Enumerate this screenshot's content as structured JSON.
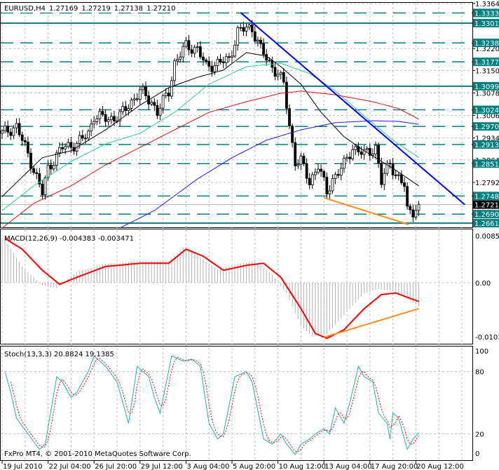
{
  "header": {
    "symbol": "EURUSD,H4",
    "open": "1.27169",
    "high": "1.27219",
    "low": "1.27138",
    "close": "1.27210"
  },
  "copyright": "FxPro MT4, © 2001-2010 MetaQuotes Software Corp.",
  "colors": {
    "teal": "#008080",
    "trend": "#0000ff",
    "divergence": "#ff8c1a",
    "ma_fast": "#000000",
    "ma_mid": "#33cc99",
    "ma_slow": "#dd1111",
    "ma_long": "#1a1aee",
    "macd_signal": "#ff0000",
    "stoch_main": "#20b2aa",
    "stoch_signal": "#ff0000"
  },
  "chart_data": [
    {
      "type": "candlestick",
      "title": "EURUSD,H4",
      "bars": 146,
      "close_anchors": [
        [
          0,
          1.2949
        ],
        [
          5,
          1.2971
        ],
        [
          9,
          1.2882
        ],
        [
          14,
          1.2758
        ],
        [
          16,
          1.2837
        ],
        [
          21,
          1.2904
        ],
        [
          26,
          1.2915
        ],
        [
          30,
          1.2949
        ],
        [
          32,
          1.3005
        ],
        [
          37,
          1.2994
        ],
        [
          41,
          1.3005
        ],
        [
          44,
          1.3039
        ],
        [
          48,
          1.3084
        ],
        [
          52,
          1.305
        ],
        [
          54,
          1.3016
        ],
        [
          58,
          1.3084
        ],
        [
          60,
          1.3173
        ],
        [
          64,
          1.3229
        ],
        [
          68,
          1.3218
        ],
        [
          71,
          1.3162
        ],
        [
          75,
          1.3173
        ],
        [
          79,
          1.3185
        ],
        [
          82,
          1.3274
        ],
        [
          85,
          1.3285
        ],
        [
          87,
          1.3285
        ],
        [
          90,
          1.3218
        ],
        [
          93,
          1.3173
        ],
        [
          96,
          1.314
        ],
        [
          98,
          1.3106
        ],
        [
          100,
          1.2971
        ],
        [
          102,
          1.2859
        ],
        [
          104,
          1.2859
        ],
        [
          107,
          1.2792
        ],
        [
          110,
          1.2848
        ],
        [
          113,
          1.2758
        ],
        [
          115,
          1.2803
        ],
        [
          119,
          1.2848
        ],
        [
          122,
          1.2904
        ],
        [
          126,
          1.2882
        ],
        [
          130,
          1.2904
        ],
        [
          132,
          1.2792
        ],
        [
          135,
          1.2859
        ],
        [
          137,
          1.2815
        ],
        [
          140,
          1.2781
        ],
        [
          141,
          1.2702
        ],
        [
          143,
          1.2702
        ],
        [
          145,
          1.2721
        ]
      ],
      "moving_averages": [
        {
          "name": "MA fast",
          "color_key": "ma_fast",
          "points": [
            [
              0,
              1.2747
            ],
            [
              14,
              1.2871
            ],
            [
              24,
              1.2893
            ],
            [
              36,
              1.296
            ],
            [
              48,
              1.3039
            ],
            [
              58,
              1.3095
            ],
            [
              68,
              1.3128
            ],
            [
              77,
              1.3151
            ],
            [
              85,
              1.3207
            ],
            [
              92,
              1.3196
            ],
            [
              97,
              1.3162
            ],
            [
              104,
              1.3106
            ],
            [
              111,
              1.3016
            ],
            [
              119,
              1.2938
            ],
            [
              126,
              1.2893
            ],
            [
              136,
              1.2837
            ],
            [
              145,
              1.2781
            ]
          ]
        },
        {
          "name": "MA mid",
          "color_key": "ma_mid",
          "points": [
            [
              0,
              1.2702
            ],
            [
              11,
              1.2781
            ],
            [
              24,
              1.2859
            ],
            [
              36,
              1.2915
            ],
            [
              48,
              1.2949
            ],
            [
              60,
              1.3016
            ],
            [
              72,
              1.3106
            ],
            [
              85,
              1.3162
            ],
            [
              97,
              1.3173
            ],
            [
              107,
              1.314
            ],
            [
              116,
              1.3084
            ],
            [
              126,
              1.3005
            ],
            [
              136,
              1.2927
            ],
            [
              145,
              1.2871
            ]
          ]
        },
        {
          "name": "MA slow",
          "color_key": "ma_slow",
          "points": [
            [
              0,
              1.2646
            ],
            [
              11,
              1.2725
            ],
            [
              24,
              1.2781
            ],
            [
              36,
              1.2848
            ],
            [
              48,
              1.2904
            ],
            [
              60,
              1.296
            ],
            [
              72,
              1.3016
            ],
            [
              85,
              1.305
            ],
            [
              97,
              1.3077
            ],
            [
              104,
              1.3084
            ],
            [
              116,
              1.3072
            ],
            [
              129,
              1.305
            ],
            [
              138,
              1.3028
            ],
            [
              145,
              1.2994
            ]
          ]
        },
        {
          "name": "MA long",
          "color_key": "ma_long",
          "points": [
            [
              41,
              1.2646
            ],
            [
              53,
              1.2702
            ],
            [
              68,
              1.2803
            ],
            [
              80,
              1.2871
            ],
            [
              92,
              1.2927
            ],
            [
              104,
              1.296
            ],
            [
              116,
              1.2983
            ],
            [
              129,
              1.2989
            ],
            [
              138,
              1.2987
            ],
            [
              145,
              1.2978
            ]
          ]
        }
      ],
      "trendlines": [
        {
          "name": "resistance",
          "color_key": "trend",
          "from": [
            83,
            1.3335
          ],
          "to": [
            161,
            1.2721
          ]
        },
        {
          "name": "price-divergence",
          "color_key": "divergence",
          "from": [
            112,
            1.2743
          ],
          "to": [
            141.5,
            1.2657
          ]
        }
      ],
      "levels": [
        {
          "value": "1.33338",
          "style": "dashed"
        },
        {
          "value": "1.33013",
          "style": "solid"
        },
        {
          "value": "1.32382",
          "style": "dashed"
        },
        {
          "value": "1.31775",
          "style": "dashed"
        },
        {
          "value": "1.30995",
          "style": "solid"
        },
        {
          "value": "1.30241",
          "style": "dashed"
        },
        {
          "value": "1.29709",
          "style": "dashed"
        },
        {
          "value": "1.29130",
          "style": "dashed"
        },
        {
          "value": "1.28519",
          "style": "dashed"
        },
        {
          "value": "1.27484",
          "style": "dashed"
        },
        {
          "value": "1.26905",
          "style": "dashed"
        },
        {
          "value": "1.26616",
          "style": "solid"
        }
      ],
      "current_price": "1.27210",
      "y_ticks": [
        "1.33640",
        "1.32200",
        "1.31500",
        "1.30780",
        "1.30060",
        "1.29340",
        "1.28640",
        "1.27920"
      ],
      "ylim": [
        1.265,
        1.3364
      ],
      "x_ticks": [
        [
          0,
          "19 Jul 2010"
        ],
        [
          16,
          "22 Jul 04:00"
        ],
        [
          32,
          "26 Jul 20:00"
        ],
        [
          48,
          "29 Jul 12:00"
        ],
        [
          64,
          "3 Aug 04:00"
        ],
        [
          80,
          "5 Aug 20:00"
        ],
        [
          96,
          "10 Aug 12:00"
        ],
        [
          112,
          "13 Aug 04:00"
        ],
        [
          128,
          "17 Aug 20:00"
        ],
        [
          144,
          "20 Aug 12:00"
        ]
      ]
    },
    {
      "type": "macd",
      "label": "MACD(12,26,9) -0.004383 -0.003471",
      "y_ticks": [
        "0.00857",
        "0.00",
        "-0.01038"
      ],
      "ylim": [
        -0.01038,
        0.00857
      ],
      "histogram": [
        [
          1,
          0.008
        ],
        [
          7,
          0.003
        ],
        [
          14,
          -0.0005
        ],
        [
          19,
          -0.001
        ],
        [
          26,
          0.002
        ],
        [
          36,
          0.0035
        ],
        [
          48,
          0.004
        ],
        [
          58,
          0.004
        ],
        [
          63,
          0.0065
        ],
        [
          68,
          0.005
        ],
        [
          75,
          0.0025
        ],
        [
          82,
          0.0035
        ],
        [
          88,
          0.004
        ],
        [
          94,
          0.0015
        ],
        [
          99,
          -0.002
        ],
        [
          104,
          -0.008
        ],
        [
          108,
          -0.01
        ],
        [
          113,
          -0.0095
        ],
        [
          119,
          -0.006
        ],
        [
          126,
          -0.002
        ],
        [
          131,
          -0.0012
        ],
        [
          136,
          -0.0015
        ],
        [
          141,
          -0.003
        ],
        [
          145,
          -0.004383
        ]
      ],
      "signal": [
        [
          1,
          0.0082
        ],
        [
          7,
          0.0062
        ],
        [
          14,
          0.0023
        ],
        [
          20,
          -0.0003
        ],
        [
          26,
          0.001
        ],
        [
          36,
          0.003
        ],
        [
          48,
          0.0036
        ],
        [
          58,
          0.0036
        ],
        [
          64,
          0.0062
        ],
        [
          70,
          0.0049
        ],
        [
          77,
          0.0023
        ],
        [
          85,
          0.0032
        ],
        [
          91,
          0.0036
        ],
        [
          97,
          0.001
        ],
        [
          104,
          -0.0048
        ],
        [
          109,
          -0.0094
        ],
        [
          113,
          -0.0103
        ],
        [
          119,
          -0.0087
        ],
        [
          126,
          -0.0048
        ],
        [
          132,
          -0.0022
        ],
        [
          137,
          -0.0019
        ],
        [
          142,
          -0.0029
        ],
        [
          145,
          -0.003471
        ]
      ],
      "divergence": {
        "from": [
          112,
          -0.0101
        ],
        "to": [
          145,
          -0.0048
        ]
      }
    },
    {
      "type": "stochastic",
      "label": "Stoch(13,3,3) 20.8824 19.1385",
      "y_ticks": [
        "100",
        "80",
        "20",
        "0"
      ],
      "ylim": [
        0,
        100
      ],
      "main": [
        [
          1,
          80
        ],
        [
          3,
          60
        ],
        [
          5,
          35
        ],
        [
          9,
          20
        ],
        [
          13,
          5
        ],
        [
          15,
          10
        ],
        [
          19,
          75
        ],
        [
          21,
          70
        ],
        [
          24,
          55
        ],
        [
          26,
          60
        ],
        [
          30,
          80
        ],
        [
          32,
          95
        ],
        [
          36,
          85
        ],
        [
          40,
          70
        ],
        [
          43,
          40
        ],
        [
          44,
          30
        ],
        [
          47,
          85
        ],
        [
          51,
          75
        ],
        [
          53,
          55
        ],
        [
          55,
          40
        ],
        [
          59,
          95
        ],
        [
          63,
          90
        ],
        [
          66,
          92
        ],
        [
          69,
          85
        ],
        [
          72,
          30
        ],
        [
          75,
          15
        ],
        [
          77,
          20
        ],
        [
          81,
          75
        ],
        [
          85,
          80
        ],
        [
          87,
          70
        ],
        [
          91,
          15
        ],
        [
          94,
          10
        ],
        [
          97,
          20
        ],
        [
          99,
          10
        ],
        [
          102,
          0
        ],
        [
          104,
          10
        ],
        [
          107,
          15
        ],
        [
          109,
          20
        ],
        [
          112,
          25
        ],
        [
          114,
          20
        ],
        [
          116,
          45
        ],
        [
          119,
          30
        ],
        [
          121,
          50
        ],
        [
          124,
          85
        ],
        [
          126,
          75
        ],
        [
          129,
          70
        ],
        [
          131,
          40
        ],
        [
          134,
          30
        ],
        [
          135,
          15
        ],
        [
          136,
          40
        ],
        [
          138,
          35
        ],
        [
          141,
          5
        ],
        [
          143,
          15
        ],
        [
          145,
          20.8824
        ]
      ]
    }
  ]
}
